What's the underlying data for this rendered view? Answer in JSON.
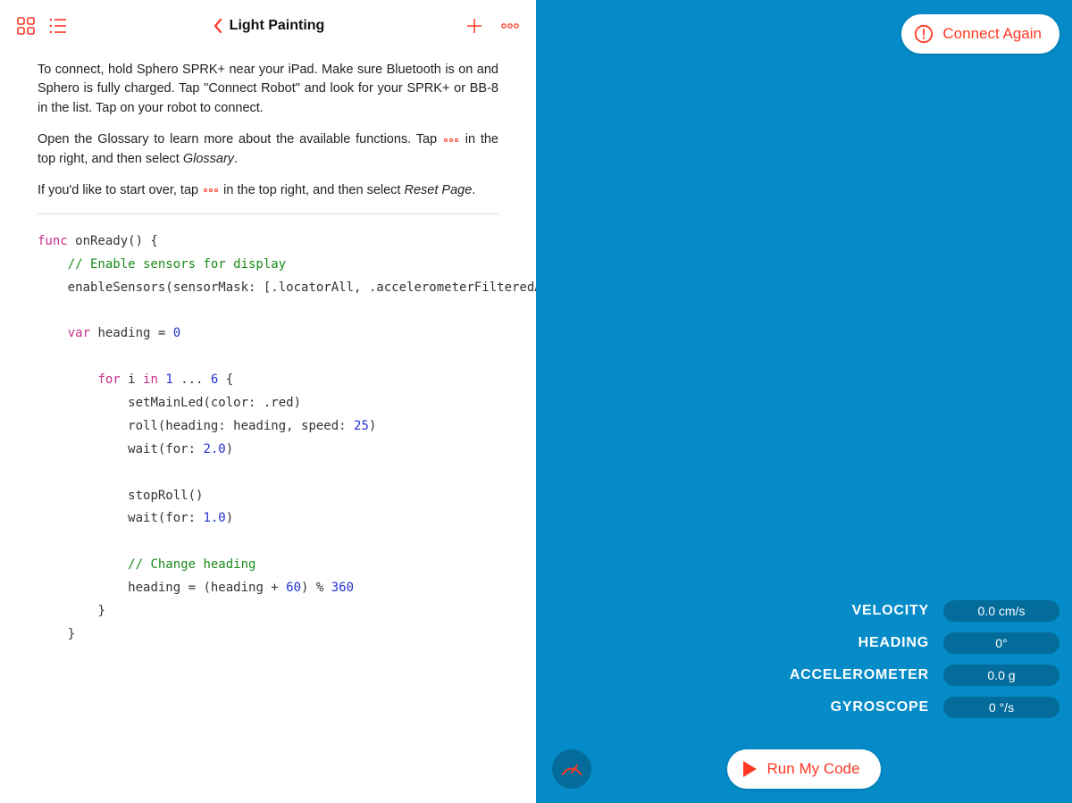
{
  "colors": {
    "accent": "#fe3824",
    "rightPane": "#058bc7"
  },
  "topbar": {
    "title": "Light Painting"
  },
  "instructions": {
    "p1_a": "To connect, hold Sphero SPRK+ near your iPad. Make sure Bluetooth is on and Sphero is fully charged. Tap \"Connect Robot\" and look for your SPRK+ or BB-8 in the list. Tap on your robot to connect.",
    "p2_a": "Open the Glossary to learn more about the available functions. Tap",
    "p2_b": "in the top right, and then select ",
    "p2_em": "Glossary",
    "p2_c": ".",
    "p3_a": "If you'd like to start over, tap",
    "p3_b": "in the top right, and then select ",
    "p3_em": "Reset Page",
    "p3_c": "."
  },
  "code": {
    "l1a": "func",
    "l1b": " onReady() {",
    "l2": "// Enable sensors for display",
    "l3": "enableSensors(sensorMask: [.locatorAll, .accelerometerFilteredAll, .gyroFilteredAll])",
    "l4a": "var",
    "l4b": " heading = ",
    "l4n": "0",
    "l5a": "for",
    "l5b": " i ",
    "l5c": "in",
    "l5d": " ",
    "l5n1": "1",
    "l5e": " ... ",
    "l5n2": "6",
    "l5f": " {",
    "l6": "setMainLed(color: .red)",
    "l7a": "roll(heading: heading, speed: ",
    "l7n": "25",
    "l7b": ")",
    "l8a": "wait(for: ",
    "l8n": "2.0",
    "l8b": ")",
    "l9": "stopRoll()",
    "l10a": "wait(for: ",
    "l10n": "1.0",
    "l10b": ")",
    "l11": "// Change heading",
    "l12a": "heading = (heading + ",
    "l12n1": "60",
    "l12b": ") % ",
    "l12n2": "360",
    "l13": "}",
    "l14": "}"
  },
  "connect": {
    "label": "Connect Again"
  },
  "metrics": {
    "items": [
      {
        "label": "VELOCITY",
        "value": "0.0 cm/s"
      },
      {
        "label": "HEADING",
        "value": "0°"
      },
      {
        "label": "ACCELEROMETER",
        "value": "0.0 g"
      },
      {
        "label": "GYROSCOPE",
        "value": "0 °/s"
      }
    ]
  },
  "run": {
    "label": "Run My Code"
  }
}
